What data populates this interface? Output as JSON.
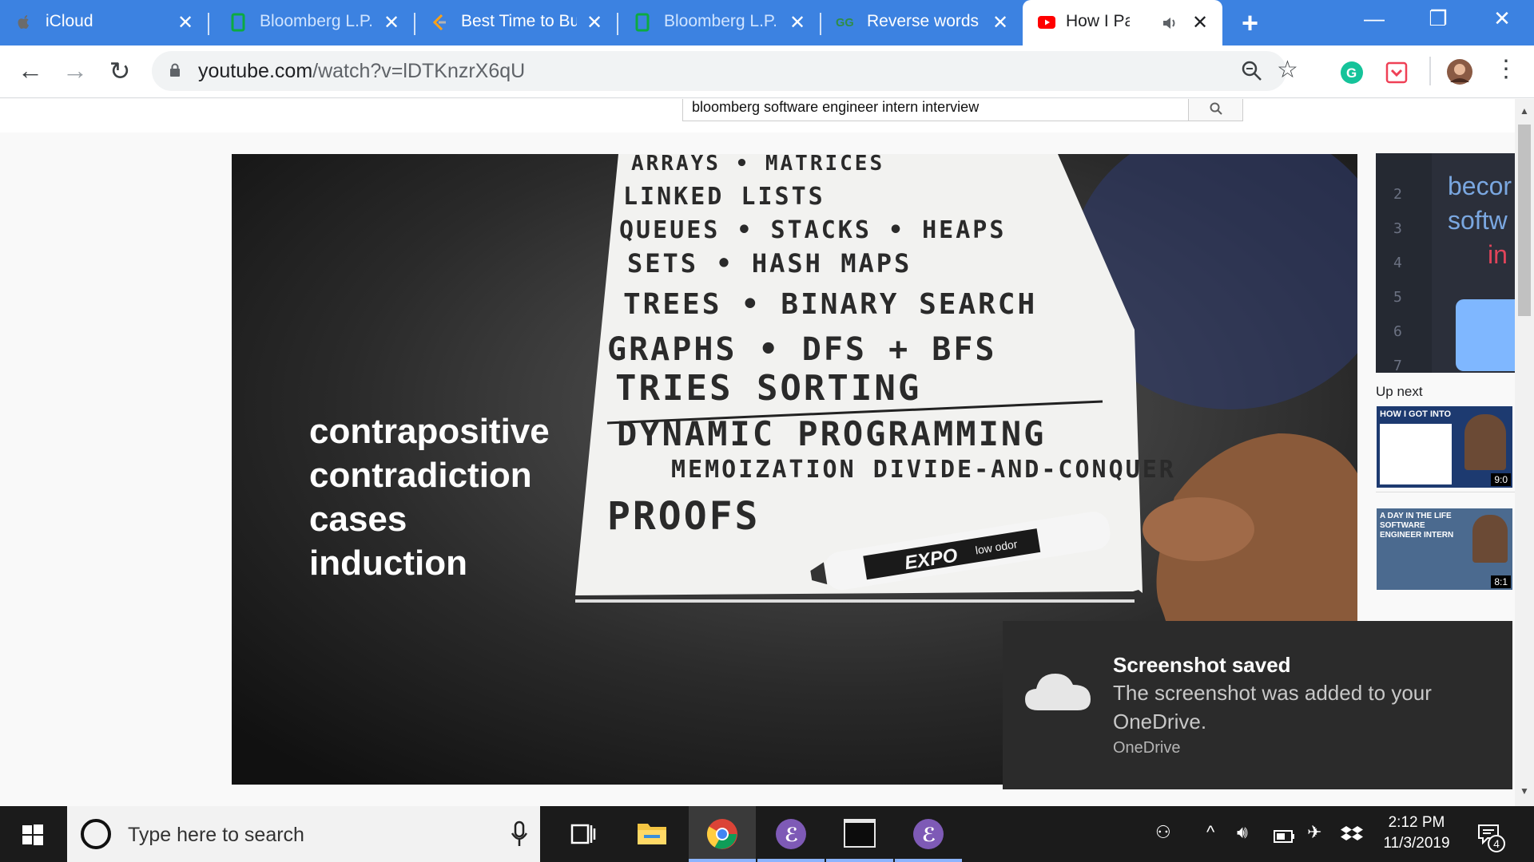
{
  "browser": {
    "tabs": [
      {
        "title": "iCloud",
        "icon": "apple-icon"
      },
      {
        "title": "Bloomberg L.P.",
        "icon": "glassdoor-icon"
      },
      {
        "title": "Best Time to Bu",
        "icon": "leetcode-icon"
      },
      {
        "title": "Bloomberg L.P.",
        "icon": "glassdoor-icon"
      },
      {
        "title": "Reverse words",
        "icon": "geeksforgeeks-icon"
      },
      {
        "title": "How I Pass",
        "icon": "youtube-icon",
        "active": true,
        "audio": true
      }
    ],
    "url_host": "youtube.com",
    "url_path": "/watch?v=lDTKnzrX6qU"
  },
  "youtube": {
    "search_query": "bloomberg software engineer intern interview",
    "video_overlay": [
      "contrapositive",
      "contradiction",
      "cases",
      "induction"
    ],
    "whiteboard_lines": [
      "ARRAYS • MATRICES",
      "LINKED LISTS",
      "QUEUES • STACKS • HEAPS",
      "SETS • HASH MAPS",
      "TREES • BINARY SEARCH",
      "GRAPHS • DFS + BFS",
      "TRIES SORTING",
      "DYNAMIC PROGRAMMING",
      "MEMOIZATION DIVIDE-AND-CONQUER",
      "PROOFS"
    ],
    "marker_text": "EXPO",
    "marker_label": "low odor",
    "sidebar_thumb_text": [
      "becor",
      "softw",
      "in"
    ],
    "sidebar_line_numbers": [
      "2",
      "3",
      "4",
      "5",
      "6",
      "7"
    ],
    "up_next_label": "Up next",
    "up_next": [
      {
        "thumb_text": "HOW I GOT INTO",
        "duration": "9:0"
      },
      {
        "thumb_text": "A DAY IN THE LIFE SOFTWARE ENGINEER INTERN",
        "duration": "8:1"
      }
    ]
  },
  "toast": {
    "title": "Screenshot saved",
    "body": "The screenshot was added to your OneDrive.",
    "app": "OneDrive"
  },
  "taskbar": {
    "search_placeholder": "Type here to search",
    "time": "2:12 PM",
    "date": "11/3/2019",
    "notifications": "4"
  },
  "colors": {
    "tab_strip": "#3c82e1",
    "youtube_red": "#ff0000",
    "toast_bg": "#2b2b2b"
  }
}
